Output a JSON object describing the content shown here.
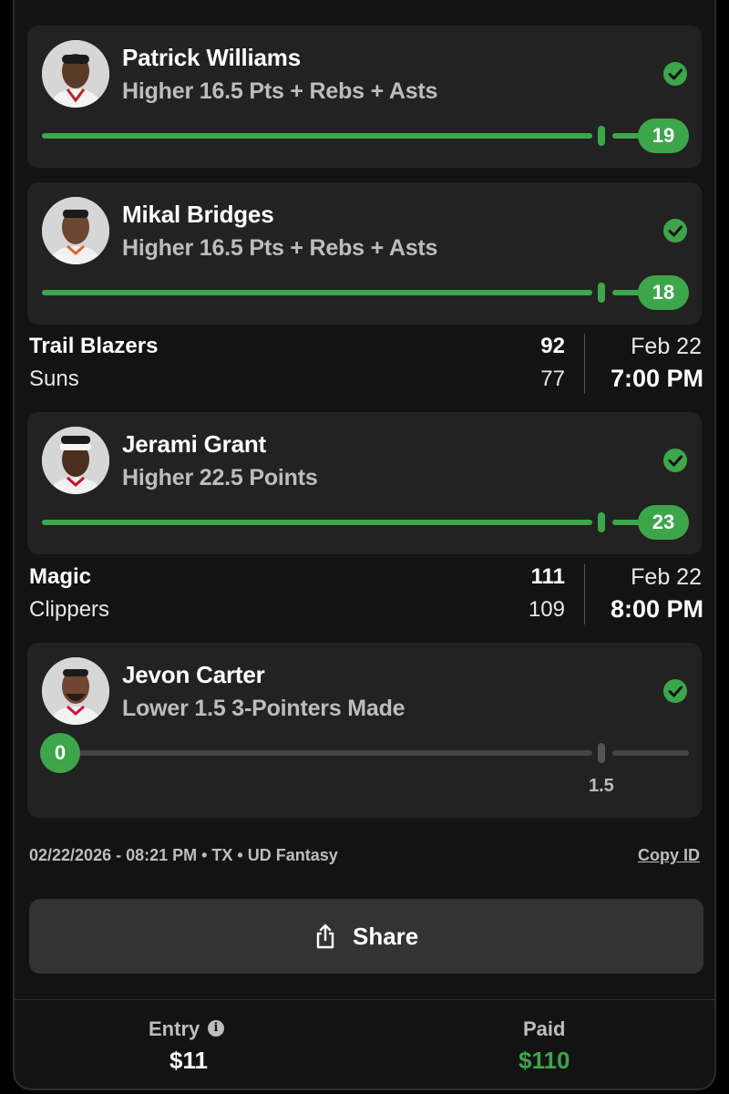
{
  "colors": {
    "accent": "#3da64a",
    "card": "#222222",
    "background": "#131313",
    "muted": "#bdbdbd"
  },
  "picks": [
    {
      "name": "Patrick Williams",
      "direction": "Higher",
      "line": "16.5",
      "stat": "Pts + Rebs + Asts",
      "result": "19",
      "status": "hit",
      "progress": 1.0
    },
    {
      "name": "Mikal Bridges",
      "direction": "Higher",
      "line": "16.5",
      "stat": "Pts + Rebs + Asts",
      "result": "18",
      "status": "hit",
      "progress": 1.0
    },
    {
      "name": "Jerami Grant",
      "direction": "Higher",
      "line": "22.5",
      "stat": "Points",
      "result": "23",
      "status": "hit",
      "progress": 1.0
    },
    {
      "name": "Jevon Carter",
      "direction": "Lower",
      "line": "1.5",
      "stat": "3-Pointers Made",
      "result": "0",
      "status": "hit",
      "progress": 0.0
    }
  ],
  "games": [
    {
      "team1": "Trail Blazers",
      "score1": "92",
      "team2": "Suns",
      "score2": "77",
      "date": "Feb 22",
      "time": "7:00 PM"
    },
    {
      "team1": "Magic",
      "score1": "111",
      "team2": "Clippers",
      "score2": "109",
      "date": "Feb 22",
      "time": "8:00 PM"
    }
  ],
  "meta": {
    "info": "02/22/2026 - 08:21 PM • TX • UD Fantasy",
    "copy_id": "Copy ID"
  },
  "share": {
    "label": "Share",
    "icon": "share-icon"
  },
  "footer": {
    "entry_label": "Entry",
    "entry_value": "$11",
    "entry_icon": "info-icon",
    "paid_label": "Paid",
    "paid_value": "$110"
  }
}
